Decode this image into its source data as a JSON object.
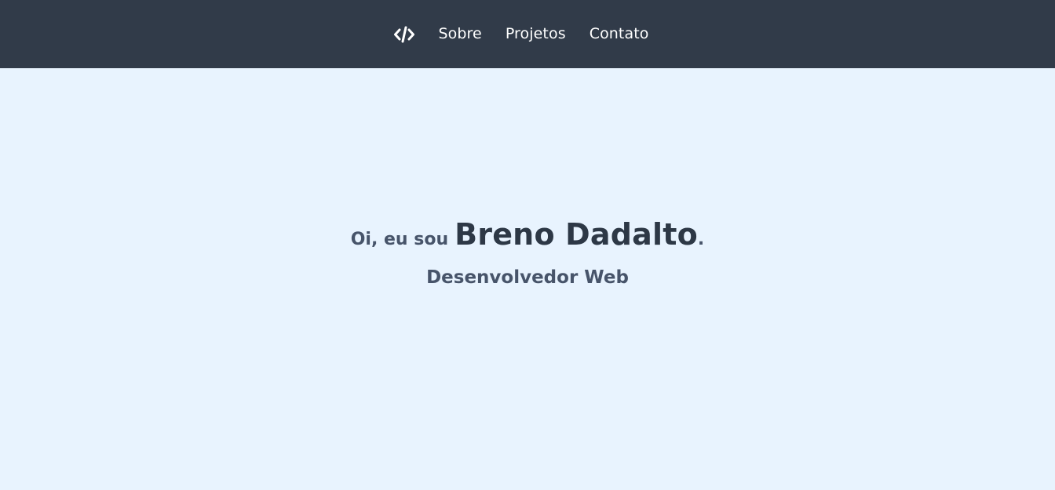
{
  "nav": {
    "logo_icon": "code-brackets-icon",
    "items": [
      {
        "label": "Sobre"
      },
      {
        "label": "Projetos"
      },
      {
        "label": "Contato"
      }
    ]
  },
  "hero": {
    "greeting": "Oi, eu sou",
    "name": "Breno Dadalto",
    "punctuation": ".",
    "subtitle": "Desenvolvedor Web"
  },
  "colors": {
    "navbar_bg": "#313b49",
    "page_bg": "#e8f3fe",
    "heading": "#2d3846",
    "text": "#47546a"
  }
}
